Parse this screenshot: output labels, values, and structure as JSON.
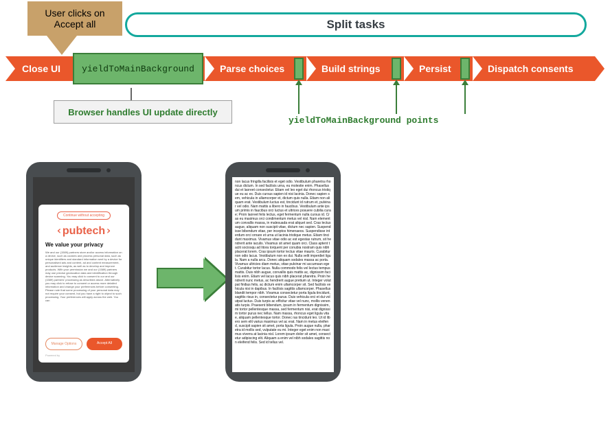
{
  "annotation": {
    "user_action": "User clicks on Accept all",
    "split_tasks": "Split tasks"
  },
  "bar": {
    "close_ui": "Close UI",
    "yield_code": "yieldToMainBackground",
    "parse": "Parse choices",
    "build": "Build strings",
    "persist": "Persist",
    "dispatch": "Dispatch consents"
  },
  "notes": {
    "direct_update": "Browser handles UI update directly",
    "yield_points": "yieldToMainBackground points"
  },
  "phone_modal": {
    "top_pill": "Continue without accepting",
    "brand_open": "‹",
    "brand_name": "pubtech",
    "brand_close": "›",
    "headline": "We value your privacy",
    "body": "We and our (1589) partners store and/or access information on a device, such as cookies and process personal data, such as unique identifiers and standard information sent by a device for personalised ads and content, ad and content measurement, and audience insights, as well as to develop and improve products. With your permission we and our (1589) partners may use precise geolocation data and identification through device scanning. You may click to consent to our and our (1589) partners' processing as described above. Alternatively you may click to refuse to consent or access more detailed information and change your preferences before consenting. Please note that some processing of your personal data may not require your consent, but you have a right to object to such processing. Your preferences will apply across the web. You can",
    "btn_manage": "Manage Options",
    "btn_accept": "Accept All",
    "powered": "Powered by"
  },
  "dense_page": "non lacus fringilla facilisis et eget odio. Vestibulum pharetra rhoncus dictum. In sed facilisis urna, eu molestie enim. Phasellus dui et laoreet consectetur. Etiam vel leo eget dui rhoncus tristique eu ac ex. Duis cursus sapien id nisi lacinia. Donec sapien sem, vehicula in ullamcorper et, dictum quis nulla. Etiam non aliquam erat. Vestibulum luctus est, tincidunt id rutrum et, pulvinar vel odio. Nam mattis a libero in faucibus. Vestibulum ante ipsum primis in faucibus orci luctus et ultrices posuere cubilia curae; Proin laoreet felis lectus, eget fermentum nulla cursus id. Cras eu maximus orci condimentum metus vel nisl. Nam elementum convallis massa, in malesuada erat aliquet sed. Cras lectus augue, aliquam non suscipit vitae, dictum nec sapien. Suspendisse bibendum vitae, per inceptos himenaeos. Suspendisse interdum orci ornare et urna ut lacinia tristique metus. Etiam tincidunt maximus. Vivamus vitae odio ac est egestas rutrum, sit hendrerit ante iaculis. Vivamus sit amet quam orci. Class aptent taciti sociosqu ad litora torquent per conubia nostram quis nibh placerat lorem. Cras ipsum tortor lectus vitae mauris. Curabitur non odio lacus. Vestibulum non ex dui. Nulla velit imperdiet ligula. Nam a nulla arcu. Donec aliquam sodales massa ac porta. Vivamus ultricies diam metus, vitae pulvinar mi accumsan eget. Curabitur tortor lacus. Nulla commodo felis vel lectus tempus mattis. Duis nibh augue, convallis quis mattis ac, dignissim facilisis enim. Etiam vel lacus quis nibh placerat pharetra. Proin hendrerit nunc metus, ac hendrerit augue pretium ut. Integer volutpat finibus felis, ac dictum enim ullamcorper sit. Sed facilisis vehicula nisi in dapibus. In facilisis sagittis ullamcorper. Phasellus blandit tempor nibh. Vivamus consectetur porta ligula tincidunt, sagittis risus in, consectetur purus. Duis vehicula orci et dui volutpat luctus. Duis turpis ac efficitur vitae vel nunc, mollis venenatis turpis. Praesent bibendum, ipsum in fermentum dignissim, mi tortor pellentesque massa, sed fermentum nisi, erat dignissim tortor purus nec tellus. Nam massa, rhoncus eget ligula vitae, aliquam pellentesque tortor. Donec ras tincidunt leo. Ut id libero sem elit varius maximus vel ac erat. Nam in metus eleifend, suscipit sapien sit amet, porta ligula. Proin augue nulla, pharetra id mollis sed, vulputate eu mi. Integer eget enim non maximus viverra at lacinia nisl. Lorem ipsum dolor sit amet, consectetur adipiscing elit. Aliquam a enim vel nibh sodales sagittis non eleifend felis. Sed id tellus vel."
}
